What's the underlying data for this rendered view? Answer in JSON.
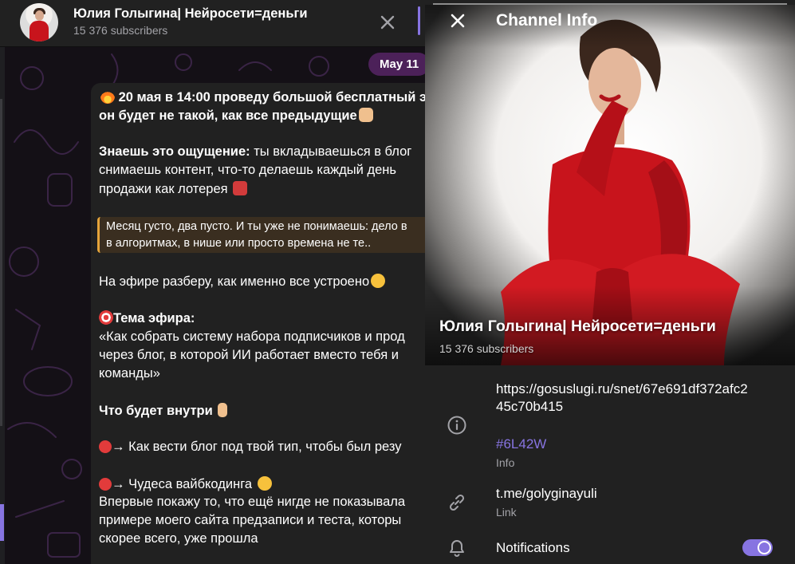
{
  "chat_header": {
    "title": "Юлия Голыгина| Нейросети=деньги",
    "subscribers": "15 376 subscribers"
  },
  "date_pill": "May 11",
  "message": {
    "line1": "20 мая в 14:00 проведу большой бесплатный э",
    "line2": "он будет не такой, как все предыдущие",
    "line3_bold": "Знаешь это ощущение:",
    "line3_rest": " ты вкладываешься в блог",
    "line4": "снимаешь контент, что-то делаешь каждый день",
    "line5": "продажи как лотерея",
    "quote_line1": "Месяц густо, два пусто. И ты уже не понимаешь: дело в",
    "quote_line2": "в алгоритмах, в нише или просто времена не те..",
    "line6": "На эфире разберу, как именно все устроено",
    "line7_bold": "Тема эфира:",
    "line8": "«Как собрать систему набора подписчиков и прод",
    "line9": "через блог, в которой ИИ работает вместо тебя и",
    "line10": "команды»",
    "line11_bold": "Что будет внутри",
    "line12": "→ Как вести блог под твой тип, чтобы был резу",
    "line13": "→ Чудеса вайбкодинга",
    "line14": "Впервые покажу то, что ещё нигде не показывала",
    "line15": "примере моего сайта предзаписи и теста, которы",
    "line16": "скорее всего, уже прошла"
  },
  "info_panel": {
    "title": "Channel Info",
    "name": "Юлия Голыгина| Нейросети=деньги",
    "subscribers": "15 376 subscribers",
    "info_line1": "https://gosuslugi.ru/snet/67e691df372afc2",
    "info_line2": "45c70b415",
    "hashtag": "#6L42W",
    "info_label": "Info",
    "link": "t.me/golyginayuli",
    "link_label": "Link",
    "notifications": "Notifications",
    "notifications_on": true
  },
  "icons": [
    "close-icon",
    "info-icon",
    "link-icon",
    "bell-icon",
    "fire-emoji",
    "slot-machine-emoji",
    "target-emoji",
    "pushpin-emoji"
  ],
  "colors": {
    "accent": "#8774e1",
    "date_pill": "#4c2159",
    "quote_bar": "#e5a43a",
    "panel": "#212121"
  }
}
